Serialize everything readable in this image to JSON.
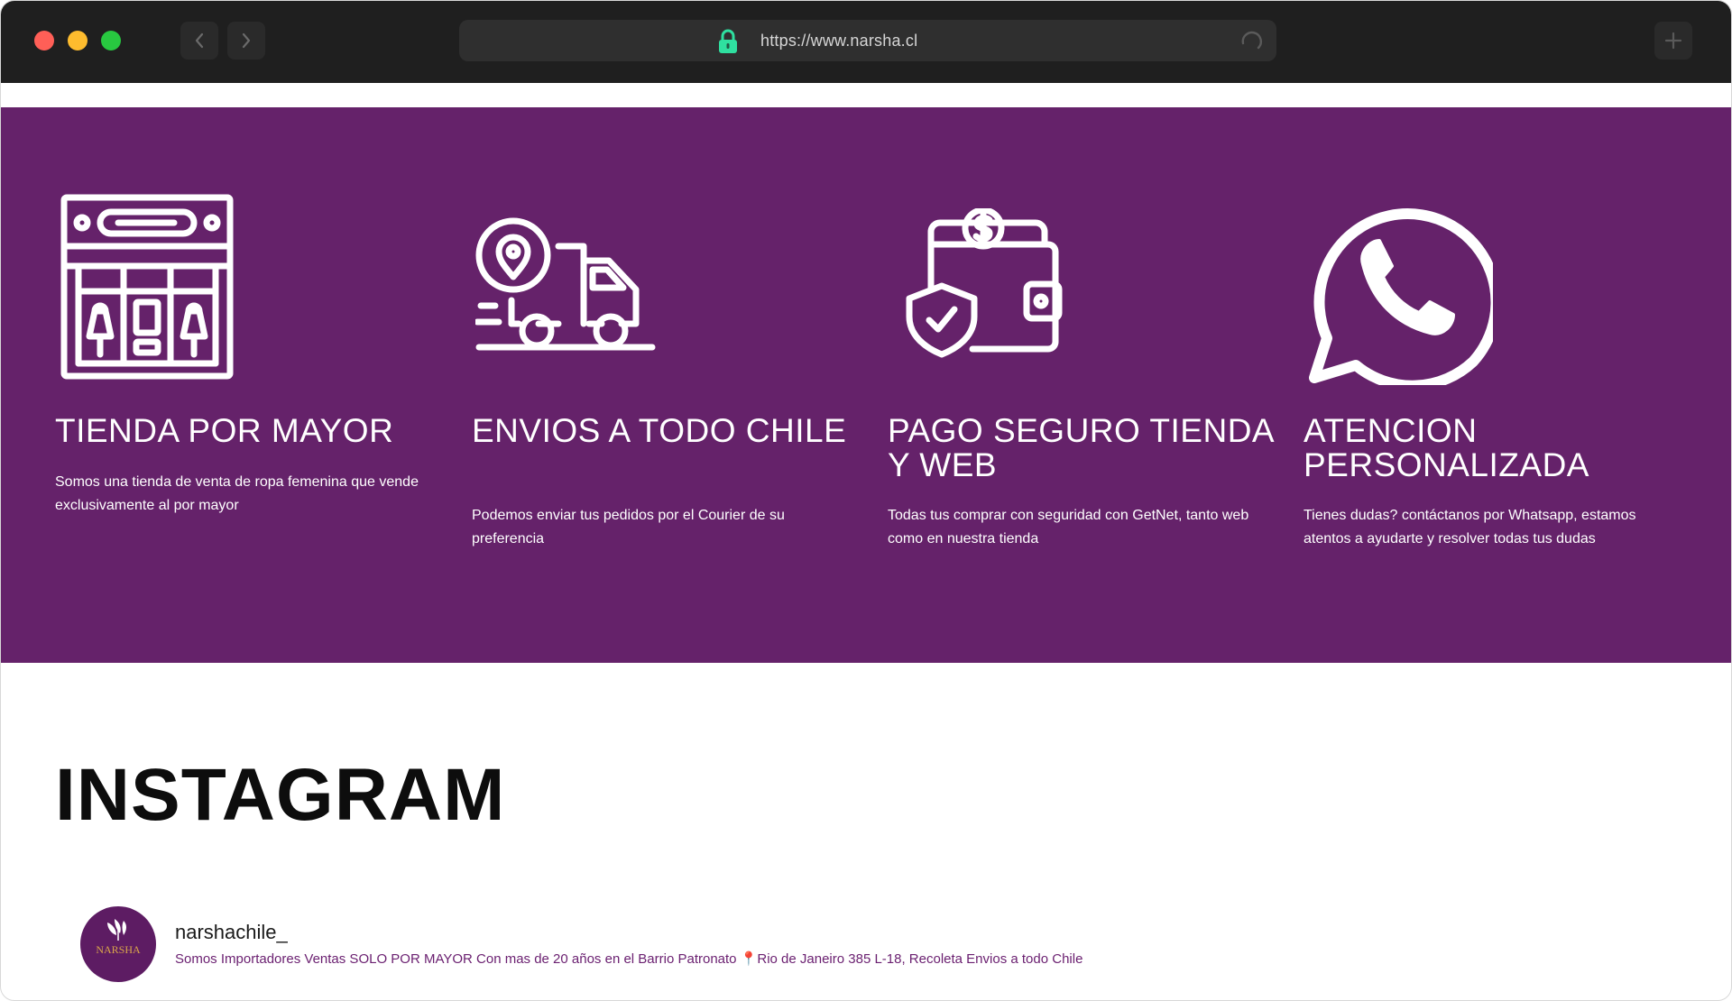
{
  "browser": {
    "url": "https://www.narsha.cl",
    "icons": [
      "back-arrow-icon",
      "forward-arrow-icon",
      "lock-icon",
      "reload-icon",
      "plus-icon"
    ]
  },
  "features": [
    {
      "icon": "store-icon",
      "title": "TIENDA POR MAYOR",
      "description": "Somos una tienda de venta de ropa femenina que vende exclusivamente al por mayor"
    },
    {
      "icon": "delivery-truck-icon",
      "title": "ENVIOS A TODO CHILE",
      "description": "Podemos enviar tus pedidos por el Courier de su preferencia"
    },
    {
      "icon": "secure-wallet-icon",
      "title": "PAGO SEGURO TIENDA Y WEB",
      "description": "Todas tus comprar con seguridad con GetNet, tanto web como en nuestra tienda"
    },
    {
      "icon": "whatsapp-icon",
      "title": "ATENCION PERSONALIZADA",
      "description": "Tienes dudas? contáctanos por Whatsapp, estamos atentos a ayudarte y resolver todas tus dudas"
    }
  ],
  "instagram": {
    "title": "INSTAGRAM",
    "username": "narshachile_",
    "bio": "Somos Importadores Ventas SOLO POR MAYOR Con mas de 20 años en el Barrio Patronato 📍Rio de Janeiro 385 L-18, Recoleta Envios a todo Chile",
    "avatar_text": "NARSHA"
  },
  "colors": {
    "brand_purple": "#65226a",
    "chrome": "#1f1f1f",
    "lock_green": "#2fe0a0"
  }
}
